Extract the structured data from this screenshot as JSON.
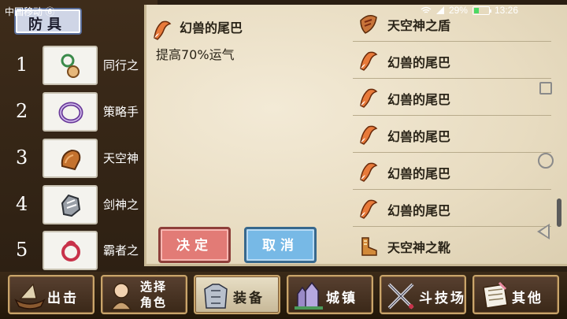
{
  "status_bar": {
    "carrier": "中国移动 ⑥",
    "battery": "29%",
    "time": "13:26"
  },
  "left_panel": {
    "category": "防具",
    "slots": [
      {
        "num": "1",
        "name": "同行之",
        "icon": "amulet-icon"
      },
      {
        "num": "2",
        "name": "策略手",
        "icon": "bracelet-icon"
      },
      {
        "num": "3",
        "name": "天空神",
        "icon": "shoulder-armor-icon"
      },
      {
        "num": "4",
        "name": "剑神之",
        "icon": "gauntlet-icon"
      },
      {
        "num": "5",
        "name": "霸者之",
        "icon": "ring-icon"
      }
    ]
  },
  "dialog": {
    "item_title": "幻兽的尾巴",
    "item_desc": "提高70%运气",
    "confirm_label": "决定",
    "cancel_label": "取消"
  },
  "item_list": [
    {
      "label": "天空神之盾",
      "icon": "shield-icon"
    },
    {
      "label": "幻兽的尾巴",
      "icon": "fox-tail-icon"
    },
    {
      "label": "幻兽的尾巴",
      "icon": "fox-tail-icon"
    },
    {
      "label": "幻兽的尾巴",
      "icon": "fox-tail-icon"
    },
    {
      "label": "幻兽的尾巴",
      "icon": "fox-tail-icon"
    },
    {
      "label": "幻兽的尾巴",
      "icon": "fox-tail-icon"
    },
    {
      "label": "天空神之靴",
      "icon": "boots-icon"
    }
  ],
  "bottom_menu": [
    {
      "label": "出击",
      "icon": "ship-icon"
    },
    {
      "label": "选择\n角色",
      "icon": "character-icon"
    },
    {
      "label": "装备",
      "icon": "armor-icon"
    },
    {
      "label": "城镇",
      "icon": "castle-icon"
    },
    {
      "label": "斗技场",
      "icon": "crossed-swords-icon"
    },
    {
      "label": "其他",
      "icon": "scroll-icon"
    }
  ],
  "colors": {
    "confirm": "#e27b76",
    "cancel": "#77b9e6",
    "parchment": "#e8dcc1",
    "frame_gold": "#c9a56b"
  }
}
